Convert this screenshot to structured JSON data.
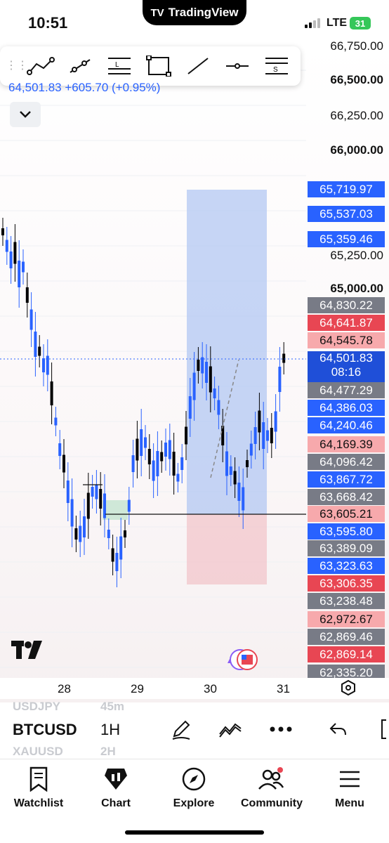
{
  "status": {
    "time": "10:51",
    "app": "TradingView",
    "network": "LTE",
    "battery": "31"
  },
  "toolbar": {
    "tools": [
      "trend-line-tool-icon",
      "ray-tool-icon",
      "long-position-tool-icon",
      "rectangle-tool-icon",
      "line-tool-icon",
      "horizontal-line-tool-icon",
      "short-position-tool-icon"
    ]
  },
  "quote": {
    "change": "64,501.83  +605.70 (+0.95%)"
  },
  "price_axis": [
    {
      "label": "66,750.00",
      "bold": false
    },
    {
      "label": "66,500.00",
      "bold": true
    },
    {
      "label": "66,250.00",
      "bold": false
    },
    {
      "label": "66,000.00",
      "bold": true
    },
    {
      "label": "65,250.00",
      "bold": false
    },
    {
      "label": "65,000.00",
      "bold": true
    }
  ],
  "price_tags": [
    {
      "label": "65,719.97",
      "kind": "blue"
    },
    {
      "label": "65,537.03",
      "kind": "blue"
    },
    {
      "label": "65,359.46",
      "kind": "blue"
    },
    {
      "label": "64,830.22",
      "kind": "gray"
    },
    {
      "label": "64,641.87",
      "kind": "red"
    },
    {
      "label": "64,545.78",
      "kind": "pink"
    },
    {
      "label": "64,477.29",
      "kind": "gray"
    },
    {
      "label": "64,386.03",
      "kind": "blue"
    },
    {
      "label": "64,240.46",
      "kind": "blue"
    },
    {
      "label": "64,169.39",
      "kind": "pink"
    },
    {
      "label": "64,096.42",
      "kind": "gray"
    },
    {
      "label": "63,867.72",
      "kind": "blue"
    },
    {
      "label": "63,668.42",
      "kind": "gray"
    },
    {
      "label": "63,605.21",
      "kind": "pink"
    },
    {
      "label": "63,595.80",
      "kind": "blue"
    },
    {
      "label": "63,389.09",
      "kind": "gray"
    },
    {
      "label": "63,323.63",
      "kind": "blue"
    },
    {
      "label": "63,306.35",
      "kind": "red"
    },
    {
      "label": "63,238.48",
      "kind": "gray"
    },
    {
      "label": "62,972.67",
      "kind": "pink"
    },
    {
      "label": "62,869.46",
      "kind": "gray"
    },
    {
      "label": "62,869.14",
      "kind": "red"
    },
    {
      "label": "62,335.20",
      "kind": "gray"
    }
  ],
  "current_price": {
    "price": "64,501.83",
    "countdown": "08:16"
  },
  "x_axis": [
    "28",
    "29",
    "30",
    "31"
  ],
  "bottom": {
    "symbol_above": "USDJPY",
    "interval_above": "45m",
    "symbol": "BTCUSD",
    "interval": "1H",
    "symbol_below": "XAUUSD",
    "interval_below": "2H"
  },
  "tabs": [
    {
      "label": "Watchlist",
      "icon": "watchlist-icon"
    },
    {
      "label": "Chart",
      "icon": "chart-icon"
    },
    {
      "label": "Explore",
      "icon": "compass-icon"
    },
    {
      "label": "Community",
      "icon": "community-icon"
    },
    {
      "label": "Menu",
      "icon": "menu-icon"
    }
  ],
  "colors": {
    "up": "#2962ff",
    "down": "#000000",
    "target_zone": "#aec4f2",
    "stop_zone": "#f2c5cb",
    "accent": "#2962ff"
  }
}
